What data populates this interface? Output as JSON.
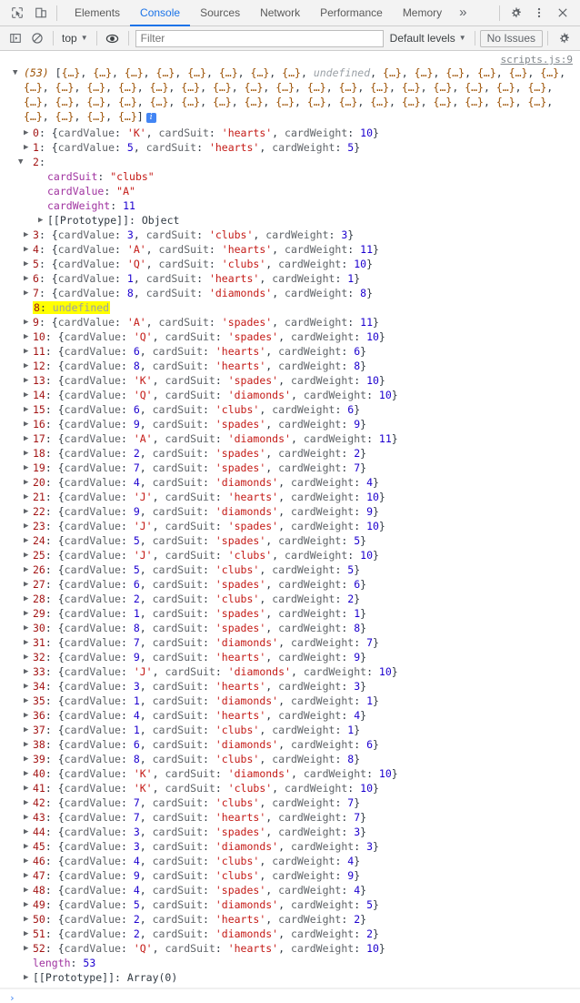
{
  "tabbar": {
    "icons": [
      {
        "name": "inspect-element-icon",
        "label": "Inspect element"
      },
      {
        "name": "device-toolbar-icon",
        "label": "Toggle device toolbar"
      }
    ],
    "tabs": [
      {
        "label": "Elements",
        "active": false
      },
      {
        "label": "Console",
        "active": true
      },
      {
        "label": "Sources",
        "active": false
      },
      {
        "label": "Network",
        "active": false
      },
      {
        "label": "Performance",
        "active": false
      },
      {
        "label": "Memory",
        "active": false
      }
    ],
    "more_label": "»",
    "settings_label": "Settings",
    "kebab_label": "Customize and control DevTools",
    "close_label": "Close DevTools"
  },
  "filterbar": {
    "clear_console_label": "Clear console",
    "sidebar_label": "Console sidebar",
    "context": "top",
    "live_expression_label": "Create live expression",
    "filter_placeholder": "Filter",
    "filter_value": "",
    "levels": "Default levels",
    "issues": "No Issues",
    "settings_label": "Console settings"
  },
  "console": {
    "source_link": "scripts.js:9",
    "array_count": "(53)",
    "open_bracket": "[",
    "close_bracket": "]",
    "obj_stub": "{…}",
    "undefined_label": "undefined",
    "info_badge": "i",
    "preview_rows": [
      {
        "stubs_before": 8,
        "undefined_at": true,
        "stubs_after": 6,
        "closes": false
      },
      {
        "stubs_before": 17,
        "undefined_at": false,
        "stubs_after": 0,
        "closes": false
      },
      {
        "stubs_before": 17,
        "undefined_at": false,
        "stubs_after": 0,
        "closes": false
      },
      {
        "stubs_before": 4,
        "undefined_at": false,
        "stubs_after": 0,
        "closes": true
      }
    ],
    "key_cardValue": "cardValue",
    "key_cardSuit": "cardSuit",
    "key_cardWeight": "cardWeight",
    "length_key": "length",
    "length_value": "53",
    "prototype_label": "[[Prototype]]",
    "prototype_array_value": "Array(0)",
    "prototype_object_value": "Object",
    "expanded_index": "2",
    "expanded": {
      "cardSuit": "\"clubs\"",
      "cardValue": "\"A\"",
      "cardWeight": "11"
    },
    "prompt_chevron": "›",
    "entries": [
      {
        "index": "0",
        "cardValue": "'K'",
        "cardValueType": "str",
        "cardSuit": "hearts",
        "cardWeight": "10"
      },
      {
        "index": "1",
        "cardValue": "5",
        "cardValueType": "num",
        "cardSuit": "hearts",
        "cardWeight": "5"
      },
      {
        "index": "2",
        "expanded": true
      },
      {
        "index": "3",
        "cardValue": "3",
        "cardValueType": "num",
        "cardSuit": "clubs",
        "cardWeight": "3"
      },
      {
        "index": "4",
        "cardValue": "'A'",
        "cardValueType": "str",
        "cardSuit": "hearts",
        "cardWeight": "11"
      },
      {
        "index": "5",
        "cardValue": "'Q'",
        "cardValueType": "str",
        "cardSuit": "clubs",
        "cardWeight": "10"
      },
      {
        "index": "6",
        "cardValue": "1",
        "cardValueType": "num",
        "cardSuit": "hearts",
        "cardWeight": "1"
      },
      {
        "index": "7",
        "cardValue": "8",
        "cardValueType": "num",
        "cardSuit": "diamonds",
        "cardWeight": "8"
      },
      {
        "index": "8",
        "undefined": true
      },
      {
        "index": "9",
        "cardValue": "'A'",
        "cardValueType": "str",
        "cardSuit": "spades",
        "cardWeight": "11"
      },
      {
        "index": "10",
        "cardValue": "'Q'",
        "cardValueType": "str",
        "cardSuit": "spades",
        "cardWeight": "10"
      },
      {
        "index": "11",
        "cardValue": "6",
        "cardValueType": "num",
        "cardSuit": "hearts",
        "cardWeight": "6"
      },
      {
        "index": "12",
        "cardValue": "8",
        "cardValueType": "num",
        "cardSuit": "hearts",
        "cardWeight": "8"
      },
      {
        "index": "13",
        "cardValue": "'K'",
        "cardValueType": "str",
        "cardSuit": "spades",
        "cardWeight": "10"
      },
      {
        "index": "14",
        "cardValue": "'Q'",
        "cardValueType": "str",
        "cardSuit": "diamonds",
        "cardWeight": "10"
      },
      {
        "index": "15",
        "cardValue": "6",
        "cardValueType": "num",
        "cardSuit": "clubs",
        "cardWeight": "6"
      },
      {
        "index": "16",
        "cardValue": "9",
        "cardValueType": "num",
        "cardSuit": "spades",
        "cardWeight": "9"
      },
      {
        "index": "17",
        "cardValue": "'A'",
        "cardValueType": "str",
        "cardSuit": "diamonds",
        "cardWeight": "11"
      },
      {
        "index": "18",
        "cardValue": "2",
        "cardValueType": "num",
        "cardSuit": "spades",
        "cardWeight": "2"
      },
      {
        "index": "19",
        "cardValue": "7",
        "cardValueType": "num",
        "cardSuit": "spades",
        "cardWeight": "7"
      },
      {
        "index": "20",
        "cardValue": "4",
        "cardValueType": "num",
        "cardSuit": "diamonds",
        "cardWeight": "4"
      },
      {
        "index": "21",
        "cardValue": "'J'",
        "cardValueType": "str",
        "cardSuit": "hearts",
        "cardWeight": "10"
      },
      {
        "index": "22",
        "cardValue": "9",
        "cardValueType": "num",
        "cardSuit": "diamonds",
        "cardWeight": "9"
      },
      {
        "index": "23",
        "cardValue": "'J'",
        "cardValueType": "str",
        "cardSuit": "spades",
        "cardWeight": "10"
      },
      {
        "index": "24",
        "cardValue": "5",
        "cardValueType": "num",
        "cardSuit": "spades",
        "cardWeight": "5"
      },
      {
        "index": "25",
        "cardValue": "'J'",
        "cardValueType": "str",
        "cardSuit": "clubs",
        "cardWeight": "10"
      },
      {
        "index": "26",
        "cardValue": "5",
        "cardValueType": "num",
        "cardSuit": "clubs",
        "cardWeight": "5"
      },
      {
        "index": "27",
        "cardValue": "6",
        "cardValueType": "num",
        "cardSuit": "spades",
        "cardWeight": "6"
      },
      {
        "index": "28",
        "cardValue": "2",
        "cardValueType": "num",
        "cardSuit": "clubs",
        "cardWeight": "2"
      },
      {
        "index": "29",
        "cardValue": "1",
        "cardValueType": "num",
        "cardSuit": "spades",
        "cardWeight": "1"
      },
      {
        "index": "30",
        "cardValue": "8",
        "cardValueType": "num",
        "cardSuit": "spades",
        "cardWeight": "8"
      },
      {
        "index": "31",
        "cardValue": "7",
        "cardValueType": "num",
        "cardSuit": "diamonds",
        "cardWeight": "7"
      },
      {
        "index": "32",
        "cardValue": "9",
        "cardValueType": "num",
        "cardSuit": "hearts",
        "cardWeight": "9"
      },
      {
        "index": "33",
        "cardValue": "'J'",
        "cardValueType": "str",
        "cardSuit": "diamonds",
        "cardWeight": "10"
      },
      {
        "index": "34",
        "cardValue": "3",
        "cardValueType": "num",
        "cardSuit": "hearts",
        "cardWeight": "3"
      },
      {
        "index": "35",
        "cardValue": "1",
        "cardValueType": "num",
        "cardSuit": "diamonds",
        "cardWeight": "1"
      },
      {
        "index": "36",
        "cardValue": "4",
        "cardValueType": "num",
        "cardSuit": "hearts",
        "cardWeight": "4"
      },
      {
        "index": "37",
        "cardValue": "1",
        "cardValueType": "num",
        "cardSuit": "clubs",
        "cardWeight": "1"
      },
      {
        "index": "38",
        "cardValue": "6",
        "cardValueType": "num",
        "cardSuit": "diamonds",
        "cardWeight": "6"
      },
      {
        "index": "39",
        "cardValue": "8",
        "cardValueType": "num",
        "cardSuit": "clubs",
        "cardWeight": "8"
      },
      {
        "index": "40",
        "cardValue": "'K'",
        "cardValueType": "str",
        "cardSuit": "diamonds",
        "cardWeight": "10"
      },
      {
        "index": "41",
        "cardValue": "'K'",
        "cardValueType": "str",
        "cardSuit": "clubs",
        "cardWeight": "10"
      },
      {
        "index": "42",
        "cardValue": "7",
        "cardValueType": "num",
        "cardSuit": "clubs",
        "cardWeight": "7"
      },
      {
        "index": "43",
        "cardValue": "7",
        "cardValueType": "num",
        "cardSuit": "hearts",
        "cardWeight": "7"
      },
      {
        "index": "44",
        "cardValue": "3",
        "cardValueType": "num",
        "cardSuit": "spades",
        "cardWeight": "3"
      },
      {
        "index": "45",
        "cardValue": "3",
        "cardValueType": "num",
        "cardSuit": "diamonds",
        "cardWeight": "3"
      },
      {
        "index": "46",
        "cardValue": "4",
        "cardValueType": "num",
        "cardSuit": "clubs",
        "cardWeight": "4"
      },
      {
        "index": "47",
        "cardValue": "9",
        "cardValueType": "num",
        "cardSuit": "clubs",
        "cardWeight": "9"
      },
      {
        "index": "48",
        "cardValue": "4",
        "cardValueType": "num",
        "cardSuit": "spades",
        "cardWeight": "4"
      },
      {
        "index": "49",
        "cardValue": "5",
        "cardValueType": "num",
        "cardSuit": "diamonds",
        "cardWeight": "5"
      },
      {
        "index": "50",
        "cardValue": "2",
        "cardValueType": "num",
        "cardSuit": "hearts",
        "cardWeight": "2"
      },
      {
        "index": "51",
        "cardValue": "2",
        "cardValueType": "num",
        "cardSuit": "diamonds",
        "cardWeight": "2"
      },
      {
        "index": "52",
        "cardValue": "'Q'",
        "cardValueType": "str",
        "cardSuit": "hearts",
        "cardWeight": "10"
      }
    ]
  },
  "colors": {
    "accent": "#1a73e8",
    "string": "#c41a16",
    "number": "#1c00cf",
    "index": "#a31515",
    "property": "#a033a0",
    "stub": "#9b4f00",
    "highlight": "#ffff00",
    "badge": "#4285f4"
  }
}
